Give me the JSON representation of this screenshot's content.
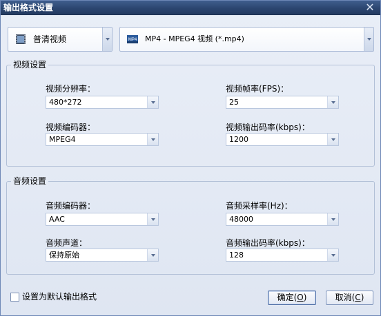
{
  "window": {
    "title": "输出格式设置",
    "close_glyph": "✕"
  },
  "format": {
    "category_label": "普清视频",
    "format_label": "MP4 - MPEG4 视频 (*.mp4)",
    "category_icon": "film-icon",
    "format_icon": "mp4-icon",
    "format_icon_text": "MP4"
  },
  "video": {
    "group_title": "视频设置",
    "resolution_label": "视频分辨率：",
    "resolution_value": "480*272",
    "fps_label": "视频帧率(FPS)：",
    "fps_value": "25",
    "encoder_label": "视频编码器：",
    "encoder_value": "MPEG4",
    "bitrate_label": "视频输出码率(kbps)：",
    "bitrate_value": "1200"
  },
  "audio": {
    "group_title": "音频设置",
    "encoder_label": "音频编码器：",
    "encoder_value": "AAC",
    "samplerate_label": "音频采样率(Hz)：",
    "samplerate_value": "48000",
    "channel_label": "音频声道：",
    "channel_value": "保持原始",
    "bitrate_label": "音频输出码率(kbps)：",
    "bitrate_value": "128"
  },
  "footer": {
    "default_checkbox_label": "设置为默认输出格式",
    "default_checked": false,
    "ok_text": "确定(",
    "ok_key": "O",
    "ok_close": ")",
    "cancel_text": "取消(",
    "cancel_key": "C",
    "cancel_close": ")"
  },
  "colors": {
    "titlebar": "#2c4670",
    "background": "#e5ebf5",
    "border": "#b2c0d7"
  }
}
